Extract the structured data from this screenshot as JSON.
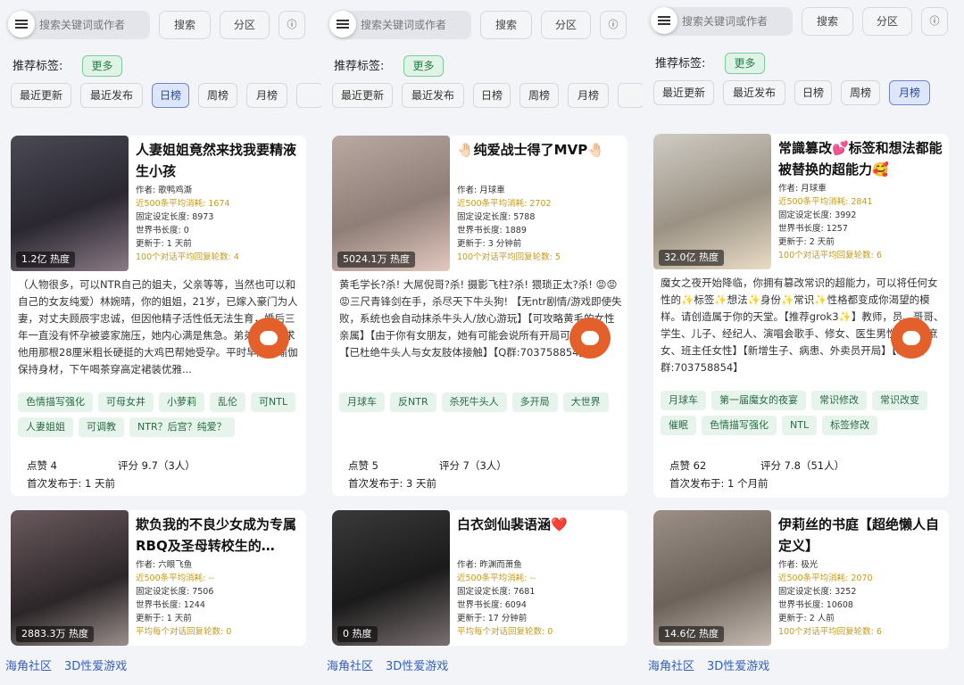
{
  "colors": {
    "accent_orange": "#e4602b",
    "tag_green": "#e6f4ec",
    "active_blue": "#dde6fa",
    "link_blue": "#3360b8"
  },
  "panels": [
    {
      "search_placeholder": "搜索关键词或作者",
      "search_btn": "搜索",
      "partition_btn": "分区",
      "info_icon": "ⓘ",
      "rec_tags_label": "推荐标签:",
      "more": "更多",
      "sorts": [
        "最近更新",
        "最近发布",
        "日榜",
        "周榜",
        "月榜",
        ""
      ],
      "active_sort": 2,
      "cards": [
        {
          "title": "人妻姐姐竟然来找我要精液生小孩",
          "heat": "1.2亿 热度",
          "meta": [
            "作者: 歌鸭鸡澌",
            "近500条平均消耗: 1674",
            "固定设定长度: 8973",
            "世界书长度: 0",
            "更新于: 1 天前",
            "100个对话平均回复轮数: 4"
          ],
          "desc": "（人物很多，可以NTR自己的姐夫，父亲等等，当然也可以和自己的女友纯爱）林婉晴，你的姐姐，21岁，已嫁入豪门为人妻，对丈夫顾辰宇忠诚，但因他精子活性低无法生育，婚后三年一直没有怀孕被婆家施压，她内心满是焦急。弟弟林皓，求他用那根28厘米粗长硬挺的大鸡巴帮她受孕。平时早起练瑜伽保持身材，下午喝茶穿高定裙装优雅...",
          "tags": [
            "色情描写强化",
            "可母女井",
            "小萝莉",
            "乱伦",
            "可NTL",
            "人妻姐姐",
            "可调教",
            "NTR？后宫？纯爱？"
          ],
          "likes": "点赞 4",
          "rating": "评分 9.7（3人）",
          "published": "首次发布于: 1 天前"
        },
        {
          "title": "欺负我的不良少女成为专属RBQ及圣母转校生的…",
          "heat": "2883.3万 热度",
          "meta": [
            "作者: 六眼飞鱼",
            "近500条平均消耗: --",
            "固定设定长度: 7506",
            "世界书长度: 1244",
            "更新于: 1 天前",
            "平均每个对话回复轮数: 0"
          ]
        }
      ],
      "bottom_links": [
        "海角社区",
        "3D性爱游戏"
      ]
    },
    {
      "search_placeholder": "搜索关键词或作者",
      "search_btn": "搜索",
      "partition_btn": "分区",
      "info_icon": "ⓘ",
      "rec_tags_label": "推荐标签:",
      "more": "更多",
      "sorts": [
        "最近更新",
        "最近发布",
        "日榜",
        "周榜",
        "月榜",
        ""
      ],
      "active_sort": -1,
      "cards": [
        {
          "title": "🤚🏻纯爱战士得了MVP🤚🏻",
          "heat": "5024.1万 热度",
          "meta": [
            "作者: 月球車",
            "近500条平均消耗: 2702",
            "固定设定长度: 5788",
            "世界书长度: 1889",
            "更新于: 3 分钟前",
            "100个对话平均回复轮数: 5"
          ],
          "desc": "黄毛学长?杀! 大屌倪哥?杀! 摄影飞柱?杀! 猥琐正太?杀! 😡😡😡三尺青锋剑在手，杀尽天下牛头狗! 【无ntr剧情/游戏即使失败，系统也会自动抹杀牛头人/放心游玩】【可攻略黄毛的女性亲属】【由于你有女朋友，她有可能会说所有开局可直奔💕】【已杜绝牛头人与女友肢体接触】【Q群:703758854】",
          "tags": [
            "月球车",
            "反NTR",
            "杀死牛头人",
            "多开局",
            "大世界"
          ],
          "likes": "点赞 5",
          "rating": "评分 7（3人）",
          "published": "首次发布于: 3 天前"
        },
        {
          "title": "白衣剑仙裴语涵❤️",
          "heat": "0 热度",
          "meta": [
            "作者: 昨渊而萧鱼",
            "近500条平均消耗: --",
            "固定设定长度: 7681",
            "世界书长度: 6094",
            "更新于: 17 分钟前",
            "平均每个对话回复轮数: 0"
          ]
        }
      ],
      "bottom_links": [
        "海角社区",
        "3D性爱游戏"
      ]
    },
    {
      "search_placeholder": "搜索关键词或作者",
      "search_btn": "搜索",
      "partition_btn": "分区",
      "info_icon": "ⓘ",
      "rec_tags_label": "推荐标签:",
      "more": "更多",
      "sorts": [
        "最近更新",
        "最近发布",
        "日榜",
        "周榜",
        "月榜"
      ],
      "active_sort": 4,
      "cards": [
        {
          "title": "常識篡改💕标签和想法都能被替换的超能力🥰",
          "heat": "32.0亿 热度",
          "meta": [
            "作者: 月球車",
            "近500条平均消耗: 2841",
            "固定设定长度: 3992",
            "世界书长度: 1257",
            "更新于: 2 天前",
            "100个对话平均回复轮数: 6"
          ],
          "desc": "魔女之夜开始降临，你拥有篡改常识的超能力，可以将任何女性的✨标签✨想法✨身份✨常识✨性格都变成你渴望的模样。请创造属于你的天堂。【推荐grok3✨】教师，员、哥哥、学生、儿子、经纪人、演唱会歌手、修女、医生男性开局、庶女、班主任女性】【新增生子、病患、外卖员开局】【聊天Q群:703758854】",
          "tags": [
            "月球车",
            "第一届魔女的夜宴",
            "常识修改",
            "常识改变",
            "催眠",
            "色情描写强化",
            "NTL",
            "标签修改"
          ],
          "likes": "点赞 62",
          "rating": "评分 7.8（51人）",
          "published": "首次发布于: 1 个月前"
        },
        {
          "title": "伊莉丝的书庭【超绝懒人自定义】",
          "heat": "14.6亿 热度",
          "meta": [
            "作者: 极光",
            "近500条平均消耗: 2070",
            "固定设定长度: 3252",
            "世界书长度: 10608",
            "更新于: 2 人前",
            "100个对话平均回复轮数: 6"
          ]
        }
      ],
      "bottom_links": [
        "海角社区",
        "3D性爱游戏"
      ]
    }
  ]
}
